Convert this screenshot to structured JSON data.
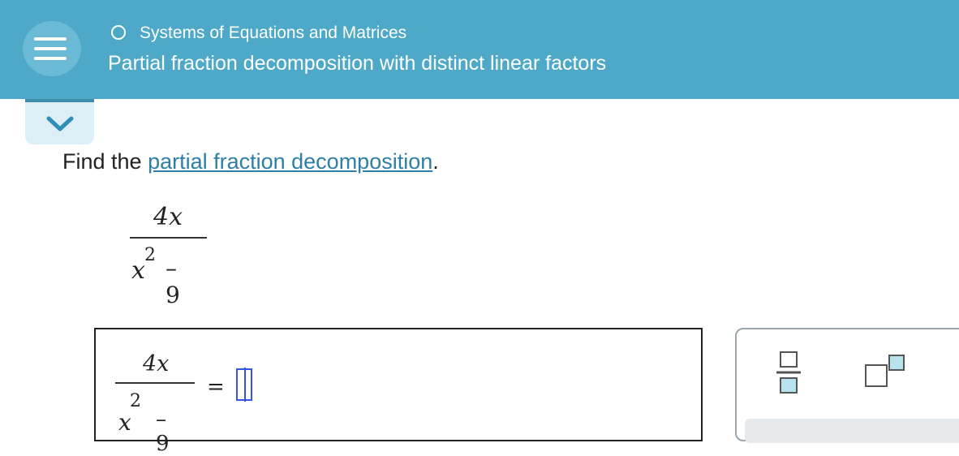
{
  "header": {
    "topic": "Systems of Equations and Matrices",
    "title": "Partial fraction decomposition with distinct linear factors",
    "menu_icon": "hamburger-icon",
    "collapse_icon": "chevron-down-icon"
  },
  "question": {
    "prefix": "Find the ",
    "link": "partial fraction decomposition",
    "suffix": "."
  },
  "expression": {
    "numerator": "4x",
    "denominator_var": "x",
    "denominator_exp": "2",
    "denominator_rest": "– 9"
  },
  "answer": {
    "numerator": "4x",
    "denominator_var": "x",
    "denominator_exp": "2",
    "denominator_rest": "– 9",
    "equals": "="
  },
  "palette": {
    "tools": [
      "fraction-icon",
      "superscript-icon"
    ]
  },
  "colors": {
    "header_bg": "#4ea9c9",
    "link": "#2d7fa6",
    "cursor": "#3355ee"
  }
}
